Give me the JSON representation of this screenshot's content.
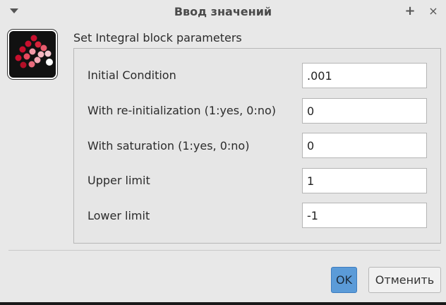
{
  "window": {
    "title": "Ввод значений",
    "maximize_glyph": "+",
    "close_glyph": "×"
  },
  "heading": "Set Integral block parameters",
  "fields": [
    {
      "label": "Initial Condition",
      "value": ".001"
    },
    {
      "label": "With re-initialization (1:yes, 0:no)",
      "value": "0"
    },
    {
      "label": "With saturation (1:yes, 0:no)",
      "value": "0"
    },
    {
      "label": "Upper limit",
      "value": "1"
    },
    {
      "label": "Lower limit",
      "value": "-1"
    }
  ],
  "buttons": {
    "ok": "OK",
    "cancel": "Отменить"
  },
  "colors": {
    "window_bg": "#e8e8e8",
    "ok_accent": "#5b9bd8",
    "icon_red": "#d81b2c",
    "icon_pink": "#f29aa8"
  },
  "icons": {
    "window_menu": "chevron-down-icon",
    "app": "scilab-dots-icon"
  }
}
